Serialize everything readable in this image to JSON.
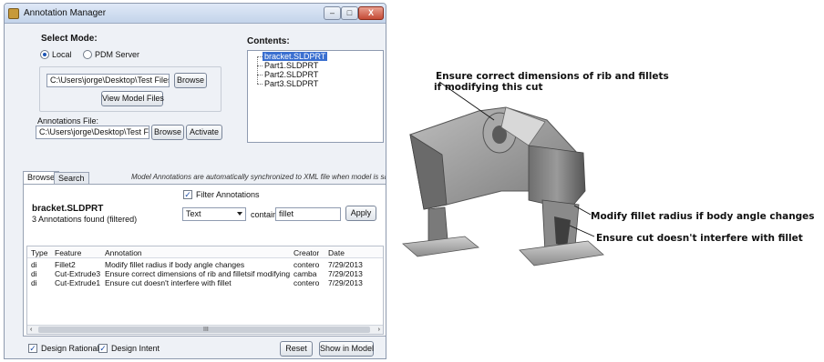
{
  "window": {
    "title": "Annotation Manager",
    "controls": {
      "minimize": "–",
      "maximize": "□",
      "close": "X"
    }
  },
  "select_mode": {
    "label": "Select Mode:",
    "options": [
      {
        "label": "Local",
        "selected": true
      },
      {
        "label": "PDM Server",
        "selected": false
      }
    ],
    "path_value": "C:\\Users\\jorge\\Desktop\\Test Files",
    "browse_label": "Browse",
    "view_model_files_label": "View Model Files"
  },
  "annotations_file": {
    "label": "Annotations File:",
    "path_value": "C:\\Users\\jorge\\Desktop\\Test Files",
    "browse_label": "Browse",
    "activate_label": "Activate"
  },
  "contents": {
    "label": "Contents:",
    "items": [
      "bracket.SLDPRT",
      "Part1.SLDPRT",
      "Part2.SLDPRT",
      "Part3.SLDPRT"
    ],
    "selected_index": 0
  },
  "tabs": [
    "Browse",
    "Search"
  ],
  "active_tab": 0,
  "sync_note": "Model Annotations are automatically synchronized to XML file when model is saved",
  "browse": {
    "filter_label": "Filter Annotations",
    "filter_checked": true,
    "model_name": "bracket.SLDPRT",
    "found_text": "3 Annotations found (filtered)",
    "filter_field": "Text",
    "contains_label": "contains",
    "contains_value": "fillet",
    "apply_label": "Apply"
  },
  "grid": {
    "columns": [
      "Type",
      "Feature",
      "Annotation",
      "Creator",
      "Date"
    ],
    "rows": [
      {
        "type": "di",
        "feature": "Fillet2",
        "annotation": "Modify fillet radius if body angle changes",
        "creator": "contero",
        "date": "7/29/2013"
      },
      {
        "type": "di",
        "feature": "Cut-Extrude3",
        "annotation": "Ensure correct dimensions of rib and filletsif modifying this cut",
        "creator": "camba",
        "date": "7/29/2013"
      },
      {
        "type": "di",
        "feature": "Cut-Extrude1",
        "annotation": "Ensure cut doesn't interfere with fillet",
        "creator": "contero",
        "date": "7/29/2013"
      }
    ],
    "scroll_left": "‹",
    "scroll_right": "›",
    "scroll_grip": "III"
  },
  "footer": {
    "design_rationale_label": "Design Rationale",
    "design_rationale_checked": true,
    "design_intent_label": "Design Intent",
    "design_intent_checked": true,
    "reset_label": "Reset",
    "show_in_model_label": "Show in Model"
  },
  "cad_callouts": {
    "rib_line1": "Ensure correct dimensions of rib and fillets",
    "rib_line2": "if modifying this cut",
    "fillet": "Modify fillet radius if body angle changes",
    "cut": "Ensure cut doesn't interfere with fillet"
  },
  "colors": {
    "selection": "#3a6fd0",
    "window_bg": "#eef1f6",
    "titlebar": "#c3d4ea",
    "close_button": "#c44a35",
    "part_gray": "#8a8a8a"
  }
}
